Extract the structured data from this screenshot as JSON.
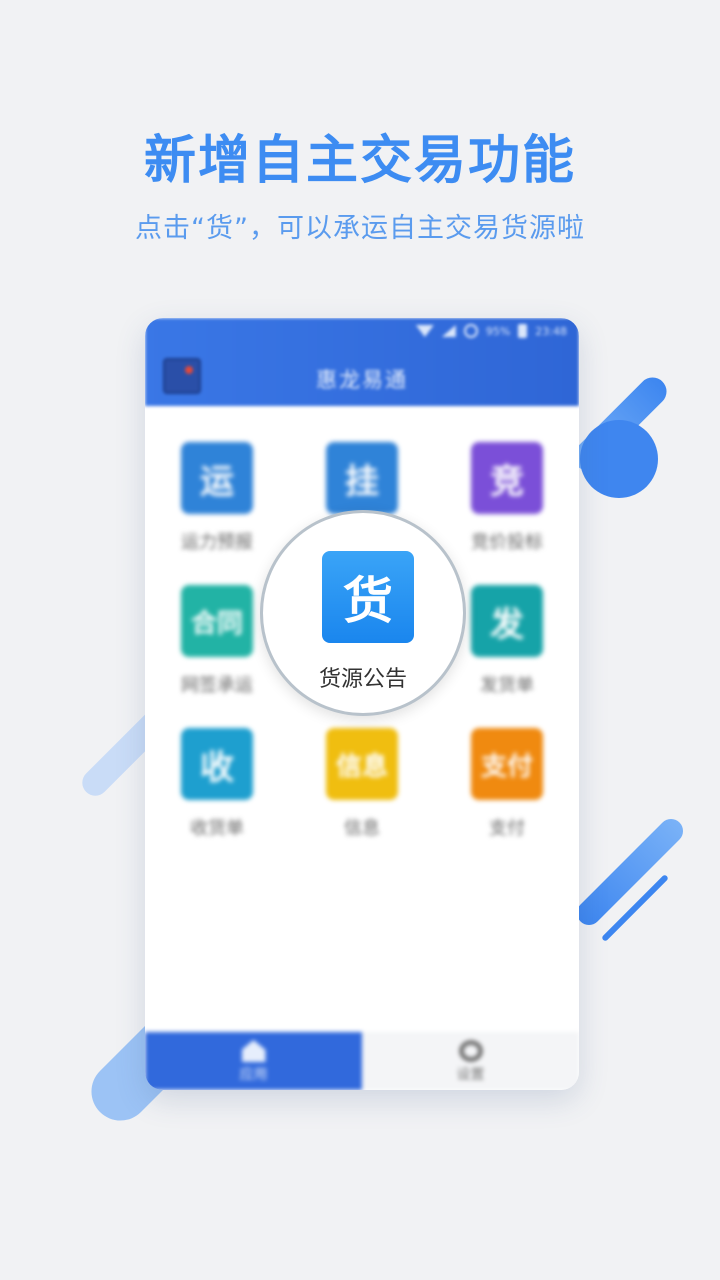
{
  "headline": "新增自主交易功能",
  "subline": "点击“货”，可以承运自主交易货源啦",
  "app": {
    "title": "惠龙易通",
    "status": {
      "battery": "95%",
      "time": "23:48"
    }
  },
  "menu": [
    {
      "glyph": "运",
      "label": "运力预报",
      "color": "#2f83d8"
    },
    {
      "glyph": "挂",
      "label": "",
      "color": "#2f83d8"
    },
    {
      "glyph": "竞",
      "label": "竞价投标",
      "color": "#7b4fd8"
    },
    {
      "glyph": "合同",
      "label": "网签承运",
      "color": "#22b3a5"
    },
    {
      "glyph": "发",
      "label": "发货单",
      "color": "#16a3a8"
    },
    {
      "glyph": "收",
      "label": "收货单",
      "color": "#1e9fcf"
    },
    {
      "glyph": "信息",
      "label": "信息",
      "color": "#f0be10"
    },
    {
      "glyph": "支付",
      "label": "支付",
      "color": "#f08a10"
    }
  ],
  "highlight": {
    "glyph": "货",
    "label": "货源公告"
  },
  "tabs": [
    {
      "label": "应用"
    },
    {
      "label": "设置"
    }
  ]
}
